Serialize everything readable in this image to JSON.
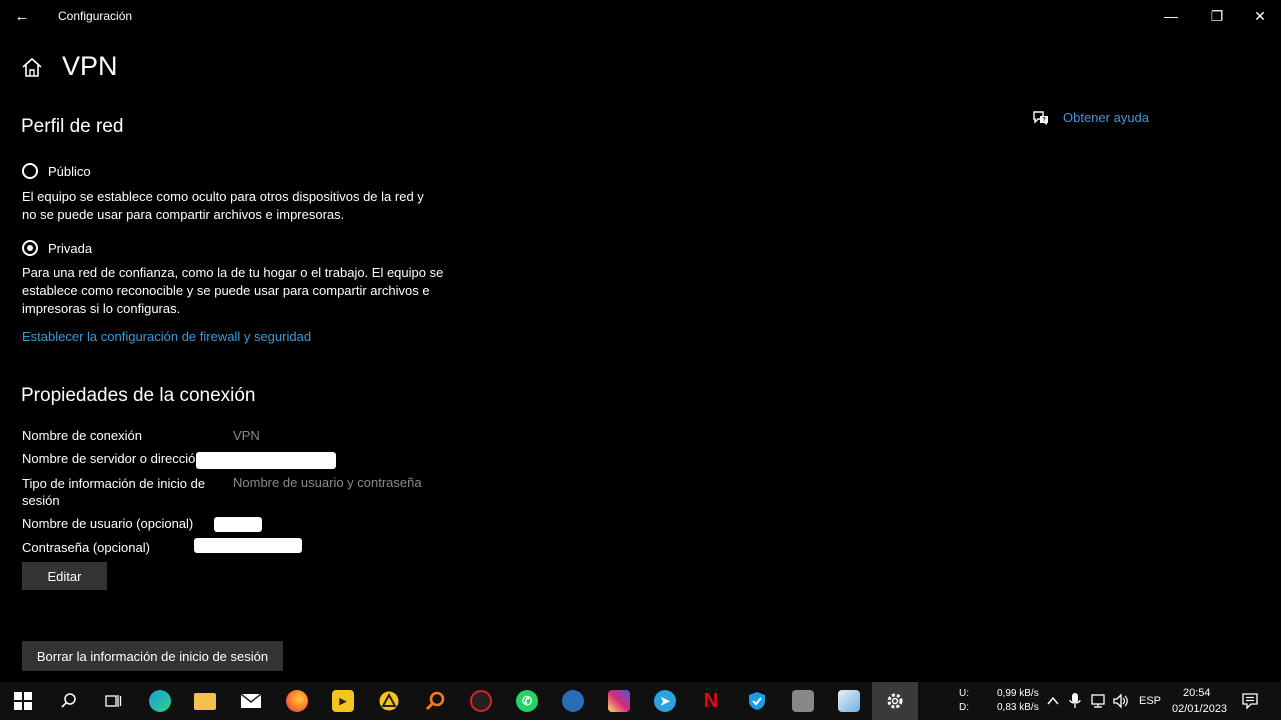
{
  "window": {
    "title": "Configuración",
    "back_glyph": "←",
    "minimize_glyph": "—",
    "maximize_glyph": "❐",
    "close_glyph": "✕"
  },
  "header": {
    "title": "VPN"
  },
  "help": {
    "label": "Obtener ayuda"
  },
  "network_profile": {
    "title": "Perfil de red",
    "options": [
      {
        "label": "Público",
        "description_line1": "El equipo se establece como oculto para otros dispositivos de la red y",
        "description_line2": "no se puede usar para compartir archivos e impresoras.",
        "selected": false
      },
      {
        "label": "Privada",
        "description_line1": "Para una red de confianza, como la de tu hogar o el trabajo. El equipo se",
        "description_line2": "establece como reconocible y se puede usar para compartir archivos e",
        "description_line3": "impresoras si lo configuras.",
        "selected": true
      }
    ],
    "firewall_link": "Establecer la configuración de firewall y seguridad"
  },
  "connection": {
    "title": "Propiedades de la conexión",
    "rows": [
      {
        "label": "Nombre de conexión",
        "value": "VPN"
      },
      {
        "label": "Nombre de servidor o direcció",
        "value": ""
      },
      {
        "label_line1": "Tipo de información de inicio de",
        "label_line2": "sesión",
        "value": "Nombre de usuario y contraseña"
      },
      {
        "label": "Nombre de usuario (opcional)",
        "value": ""
      },
      {
        "label": "Contraseña (opcional)",
        "value": ""
      }
    ],
    "edit_button": "Editar",
    "clear_button": "Borrar la información de inicio de sesión"
  },
  "taskbar": {
    "icons": [
      "windows-start",
      "search",
      "task-view",
      "edge",
      "file-explorer",
      "mail",
      "firefox",
      "pot-player",
      "avast-like",
      "search-orange",
      "red-app",
      "whatsapp",
      "app-blue",
      "instagram",
      "telegram",
      "netflix",
      "shield-app",
      "game-app",
      "paint-app",
      "settings"
    ],
    "net_up_label": "U:",
    "net_down_label": "D:",
    "net_up": "0,99 kB/s",
    "net_down": "0,83 kB/s",
    "language": "ESP",
    "time": "20:54",
    "date": "02/01/2023"
  },
  "colors": {
    "accent_link": "#3b9ad8",
    "background": "#000000",
    "button": "#333333",
    "taskbar": "#101010"
  }
}
